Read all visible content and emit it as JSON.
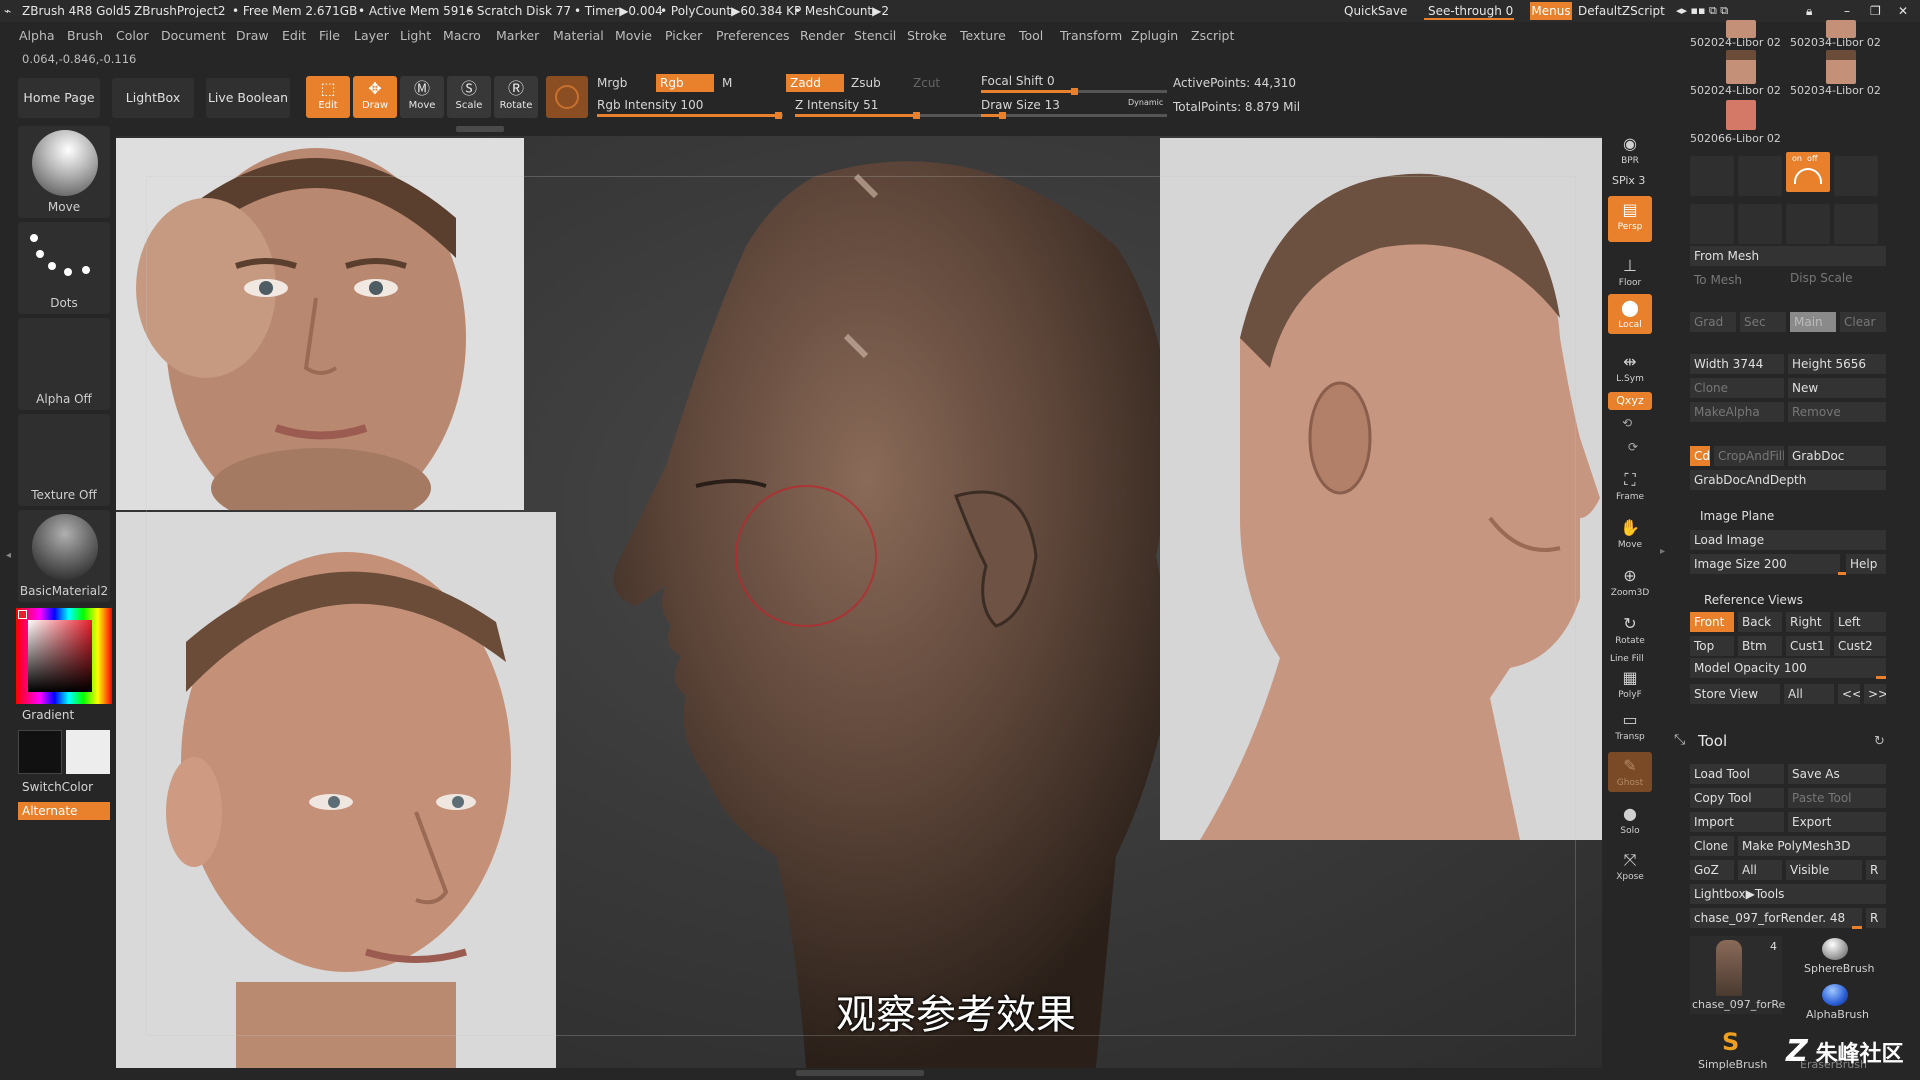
{
  "titlebar": {
    "app_title": "ZBrush 4R8 Gold5",
    "project": "ZBrushProject2",
    "free_mem": "• Free Mem 2.671GB",
    "active_mem": "• Active Mem 5916",
    "scratch": "• Scratch Disk 77",
    "timer": "• Timer▶0.004",
    "polycount": "• PolyCount▶60.384 KP",
    "meshcount": "• MeshCount▶2",
    "quicksave": "QuickSave",
    "see_through": "See-through  0",
    "menus": "Menus",
    "default_zscript": "DefaultZScript"
  },
  "menu": [
    "Alpha",
    "Brush",
    "Color",
    "Document",
    "Draw",
    "Edit",
    "File",
    "Layer",
    "Light",
    "Macro",
    "Marker",
    "Material",
    "Movie",
    "Picker",
    "Preferences",
    "Render",
    "Stencil",
    "Stroke",
    "Texture",
    "Tool",
    "Transform",
    "Zplugin",
    "Zscript"
  ],
  "coords": "0.064,-0.846,-0.116",
  "toolbar": {
    "home_page": "Home Page",
    "lightbox": "LightBox",
    "live_boolean": "Live Boolean",
    "edit": "Edit",
    "draw": "Draw",
    "move": "Move",
    "scale": "Scale",
    "rotate": "Rotate",
    "mrgb": "Mrgb",
    "rgb": "Rgb",
    "m": "M",
    "rgb_intensity": "Rgb Intensity 100",
    "zadd": "Zadd",
    "zsub": "Zsub",
    "zcut": "Zcut",
    "z_intensity": "Z Intensity 51",
    "focal_shift": "Focal Shift 0",
    "draw_size": "Draw Size 13",
    "dynamic": "Dynamic",
    "active_points": "ActivePoints: 44,310",
    "total_points": "TotalPoints: 8.879 Mil"
  },
  "left_shelf": {
    "brush": "Move",
    "stroke": "Dots",
    "alpha": "Alpha Off",
    "texture": "Texture Off",
    "material": "BasicMaterial2",
    "gradient": "Gradient",
    "switch_color": "SwitchColor",
    "alternate": "Alternate"
  },
  "canvas": {
    "subtitle": "观察参考效果"
  },
  "right_strip": {
    "bpr": "BPR",
    "spix": "SPix 3",
    "persp": "Persp",
    "floor": "Floor",
    "local": "Local",
    "lsym": "L.Sym",
    "xyz": "Qxyz",
    "frame": "Frame",
    "move": "Move",
    "zoom3d": "Zoom3D",
    "rotate": "Rotate",
    "line_fill": "Line Fill",
    "polyf": "PolyF",
    "transp": "Transp",
    "ghost": "Ghost",
    "solo": "Solo",
    "xpose": "Xpose"
  },
  "right_panel": {
    "image_thumbs": [
      "502024-Libor 02",
      "502034-Libor 02",
      "502024-Libor 02",
      "502034-Libor 02",
      "502066-Libor 02"
    ],
    "on_off": "on  off",
    "from_mesh": "From Mesh",
    "to_mesh": "To Mesh",
    "disp_scale": "Disp Scale",
    "grad": "Grad",
    "sec": "Sec",
    "main": "Main",
    "clear": "Clear",
    "width": "Width 3744",
    "height": "Height 5656",
    "clone": "Clone",
    "new": "New",
    "make_alpha": "MakeAlpha",
    "remove": "Remove",
    "cd": "Cd",
    "crop_and_fill": "CropAndFill",
    "grab_doc": "GrabDoc",
    "grab_doc_and_depth": "GrabDocAndDepth",
    "image_plane": "Image Plane",
    "load_image": "Load Image",
    "image_size": "Image Size 200",
    "help": "Help",
    "reference_views": "Reference Views",
    "front": "Front",
    "back": "Back",
    "right": "Right",
    "left": "Left",
    "top": "Top",
    "btm": "Btm",
    "cust1": "Cust1",
    "cust2": "Cust2",
    "model_opacity": "Model Opacity 100",
    "store_view": "Store View",
    "all": "All",
    "prev": "<<",
    "next": ">>",
    "tool_title": "Tool",
    "load_tool": "Load Tool",
    "save_as": "Save As",
    "copy_tool": "Copy Tool",
    "paste_tool": "Paste Tool",
    "import": "Import",
    "export": "Export",
    "clone2": "Clone",
    "make_polymesh": "Make PolyMesh3D",
    "goz": "GoZ",
    "all2": "All",
    "visible": "Visible",
    "r": "R",
    "lightbox_tools": "Lightbox▶Tools",
    "current_tool": "chase_097_forRender. 48",
    "tool_count": "4",
    "tool_thumbs": [
      "chase_097_forRe",
      "SphereBrush",
      "AlphaBrush",
      "SimpleBrush",
      "EraserBrush"
    ]
  },
  "watermark": "朱峰社区"
}
